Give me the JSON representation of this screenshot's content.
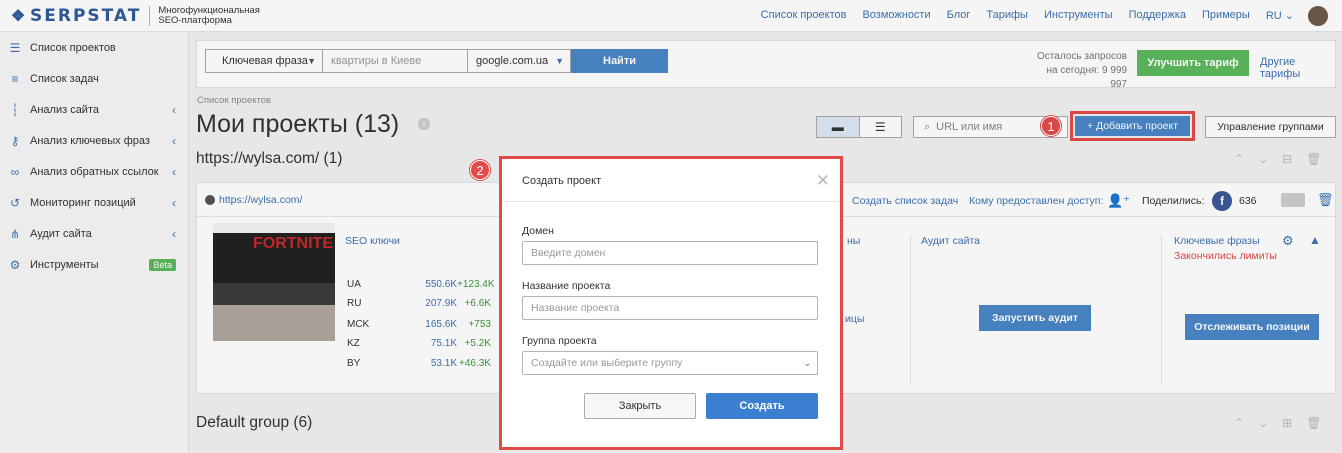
{
  "header": {
    "logo_text": "SERPSTAT",
    "logo_subtitle": "Многофункциональная SEO-платформа",
    "nav": [
      "Список проектов",
      "Возможности",
      "Блог",
      "Тарифы",
      "Инструменты",
      "Поддержка",
      "Примеры",
      "RU"
    ]
  },
  "sidebar": {
    "items": [
      {
        "label": "Список проектов",
        "icon": "menu-icon"
      },
      {
        "label": "Список задач",
        "icon": "list-icon"
      },
      {
        "label": "Анализ сайта",
        "icon": "site-analysis-icon"
      },
      {
        "label": "Анализ ключевых фраз",
        "icon": "key-icon"
      },
      {
        "label": "Анализ обратных ссылок",
        "icon": "link-icon"
      },
      {
        "label": "Мониторинг позиций",
        "icon": "history-icon"
      },
      {
        "label": "Аудит сайта",
        "icon": "sitemap-icon"
      },
      {
        "label": "Инструменты",
        "icon": "gear-icon"
      }
    ],
    "beta_label": "Beta"
  },
  "search": {
    "type_select": "Ключевая фраза",
    "query_placeholder": "квартиры в Киеве",
    "region": "google.com.ua",
    "submit": "Найти",
    "limits_line1": "Осталось запросов",
    "limits_line2": "на сегодня: 9 999 997",
    "upgrade": "Улучшить тариф",
    "other_plans": "Другие тарифы"
  },
  "page": {
    "breadcrumb": "Список проектов",
    "title": "Мои проекты (13)",
    "info": "i",
    "url_search_placeholder": "URL или имя",
    "add_project": "+ Добавить проект",
    "manage_groups": "Управление группами",
    "badge1": "1",
    "badge2": "2"
  },
  "group1": {
    "title": "https://wylsa.com/ (1)"
  },
  "project": {
    "url": "https://wylsa.com/",
    "create_tasks": "Создать список задач",
    "access": "Кому предоставлен доступ:",
    "shared": "Поделились:",
    "fb_letter": "f",
    "shares_count": "636",
    "thumb_text": "FORTNITE",
    "seo_title": "SEO ключи",
    "seo_rows": [
      {
        "country": "UA",
        "value": "550.6K",
        "delta": "+123.4K"
      },
      {
        "country": "RU",
        "value": "207.9K",
        "delta": "+6.6K"
      },
      {
        "country": "MCK",
        "value": "165.6K",
        "delta": "+753"
      },
      {
        "country": "KZ",
        "value": "75.1K",
        "delta": "+5.2K"
      },
      {
        "country": "BY",
        "value": "53.1K",
        "delta": "+46.3K"
      }
    ],
    "partial_col_title": "ны",
    "partial_col_text": "ицы",
    "audit_title": "Аудит сайта",
    "audit_button": "Запустить аудит",
    "kw_title": "Ключевые фразы",
    "kw_warning": "Закончились лимиты",
    "track_button": "Отслеживать позиции"
  },
  "group2": {
    "title": "Default group (6)"
  },
  "modal": {
    "title": "Создать проект",
    "domain_label": "Домен",
    "domain_placeholder": "Введите домен",
    "name_label": "Название проекта",
    "name_placeholder": "Название проекта",
    "group_label": "Группа проекта",
    "group_placeholder": "Создайте или выберите группу",
    "close_button": "Закрыть",
    "create_button": "Создать"
  },
  "colors": {
    "brand": "#2f5c9a",
    "primary": "#4a86c7",
    "success": "#5cb85c",
    "highlight": "#e24a4a"
  }
}
